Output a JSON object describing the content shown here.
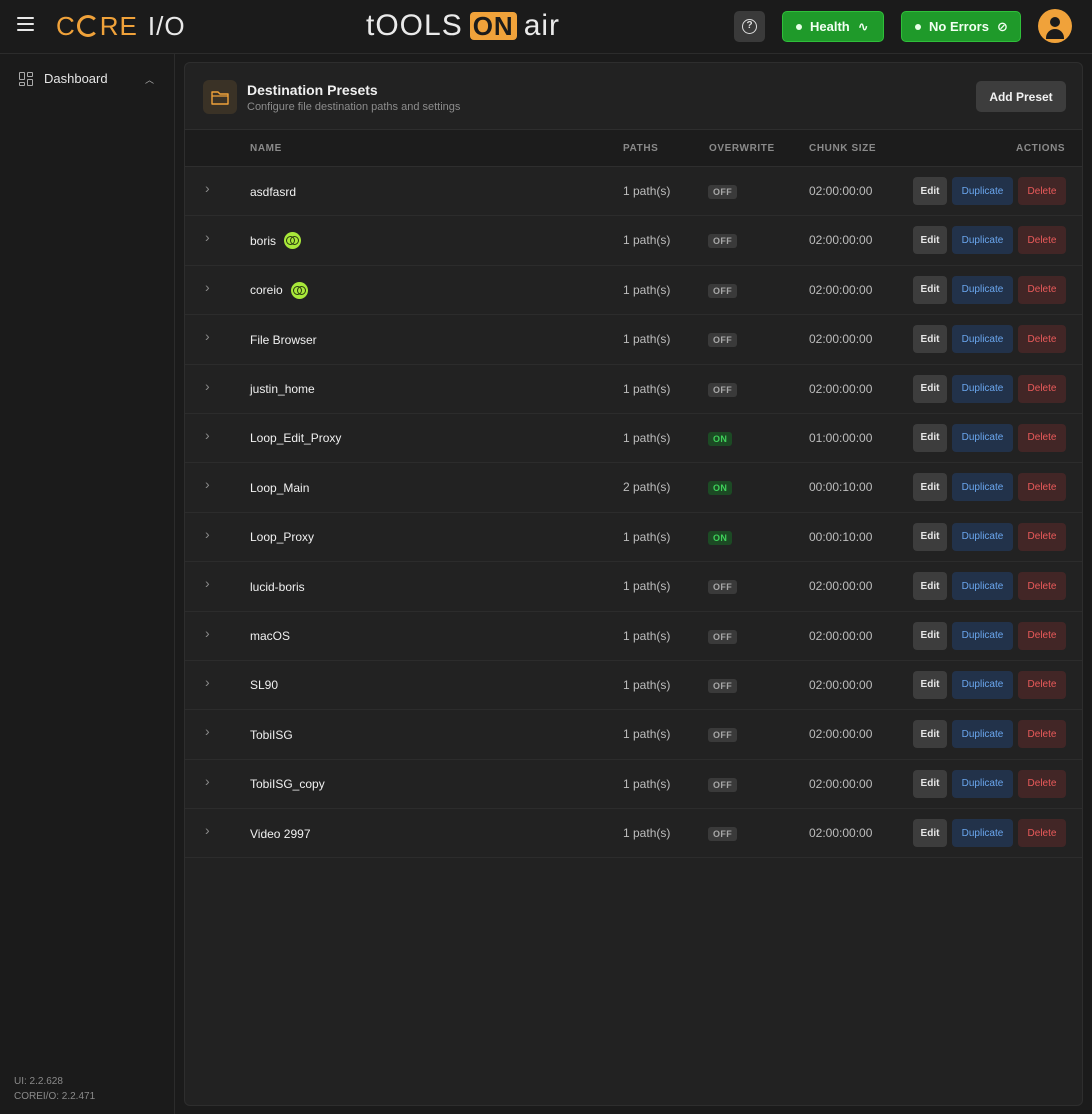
{
  "header": {
    "logo_core": "C",
    "logo_core_rest": "RE",
    "logo_io": "I/O",
    "logo_toa_left": "tOOLS",
    "logo_toa_on": "ON",
    "logo_toa_right": "air",
    "help_label": "?",
    "health_label": "Health",
    "errors_label": "No Errors"
  },
  "sidebar": {
    "items": [
      {
        "label": "Dashboard"
      }
    ],
    "ui_version": "UI: 2.2.628",
    "core_version": "COREI/O: 2.2.471"
  },
  "card": {
    "title": "Destination Presets",
    "subtitle": "Configure file destination paths and settings",
    "add_label": "Add Preset"
  },
  "table": {
    "headers": {
      "name": "NAME",
      "paths": "PATHS",
      "overwrite": "OVERWRITE",
      "chunk": "CHUNK SIZE",
      "actions": "ACTIONS"
    },
    "action_labels": {
      "edit": "Edit",
      "duplicate": "Duplicate",
      "delete": "Delete"
    },
    "rows": [
      {
        "name": "asdfasrd",
        "synced": false,
        "paths": "1 path(s)",
        "overwrite": "OFF",
        "chunk": "02:00:00:00"
      },
      {
        "name": "boris",
        "synced": true,
        "paths": "1 path(s)",
        "overwrite": "OFF",
        "chunk": "02:00:00:00"
      },
      {
        "name": "coreio",
        "synced": true,
        "paths": "1 path(s)",
        "overwrite": "OFF",
        "chunk": "02:00:00:00"
      },
      {
        "name": "File Browser",
        "synced": false,
        "paths": "1 path(s)",
        "overwrite": "OFF",
        "chunk": "02:00:00:00"
      },
      {
        "name": "justin_home",
        "synced": false,
        "paths": "1 path(s)",
        "overwrite": "OFF",
        "chunk": "02:00:00:00"
      },
      {
        "name": "Loop_Edit_Proxy",
        "synced": false,
        "paths": "1 path(s)",
        "overwrite": "ON",
        "chunk": "01:00:00:00"
      },
      {
        "name": "Loop_Main",
        "synced": false,
        "paths": "2 path(s)",
        "overwrite": "ON",
        "chunk": "00:00:10:00"
      },
      {
        "name": "Loop_Proxy",
        "synced": false,
        "paths": "1 path(s)",
        "overwrite": "ON",
        "chunk": "00:00:10:00"
      },
      {
        "name": "lucid-boris",
        "synced": false,
        "paths": "1 path(s)",
        "overwrite": "OFF",
        "chunk": "02:00:00:00"
      },
      {
        "name": "macOS",
        "synced": false,
        "paths": "1 path(s)",
        "overwrite": "OFF",
        "chunk": "02:00:00:00"
      },
      {
        "name": "SL90",
        "synced": false,
        "paths": "1 path(s)",
        "overwrite": "OFF",
        "chunk": "02:00:00:00"
      },
      {
        "name": "TobiISG",
        "synced": false,
        "paths": "1 path(s)",
        "overwrite": "OFF",
        "chunk": "02:00:00:00"
      },
      {
        "name": "TobiISG_copy",
        "synced": false,
        "paths": "1 path(s)",
        "overwrite": "OFF",
        "chunk": "02:00:00:00"
      },
      {
        "name": "Video 2997",
        "synced": false,
        "paths": "1 path(s)",
        "overwrite": "OFF",
        "chunk": "02:00:00:00"
      }
    ]
  },
  "colors": {
    "accent": "#f0a23a",
    "status_green": "#1f9a2a",
    "sync_badge": "#a8e83a",
    "duplicate_text": "#6aa6ee",
    "delete_text": "#ea5a5a"
  }
}
